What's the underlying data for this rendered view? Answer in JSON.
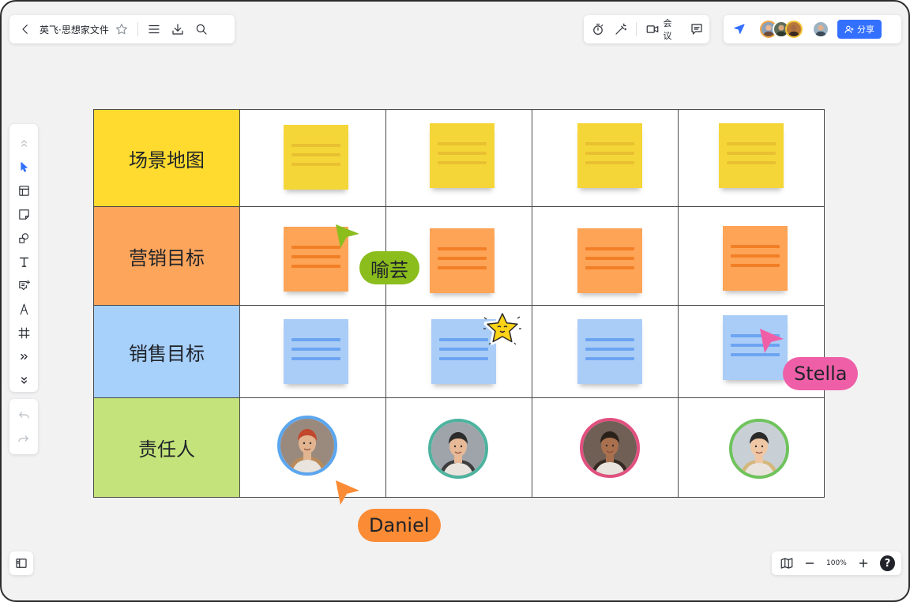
{
  "toolbar": {
    "doc_title": "英飞·思想家文件",
    "meeting_label": "会议",
    "share_label": "分享"
  },
  "zoom": {
    "level": "100%",
    "help": "?"
  },
  "board": {
    "rows": [
      {
        "label": "场景地图",
        "label_color": "#fedb2e",
        "note_color": "#f5d638",
        "note_line_color": "#e8c031"
      },
      {
        "label": "营销目标",
        "label_color": "#fea55c",
        "note_color": "#fda457",
        "note_line_color": "#f27f25"
      },
      {
        "label": "销售目标",
        "label_color": "#a7d0fb",
        "note_color": "#aacdf7",
        "note_line_color": "#6da4f2"
      },
      {
        "label": "责任人",
        "label_color": "#c4e37a"
      }
    ],
    "owners": [
      {
        "ring_color": "#5ba6ef",
        "bg": "#9a8a7e",
        "skin": "#e2b590",
        "hat": "#c1472d",
        "hair": "#c08a52"
      },
      {
        "ring_color": "#4db39f",
        "bg": "#9fa4aa",
        "skin": "#e7b997",
        "hat": "#2c2c2c",
        "hair": "#2c2c2c"
      },
      {
        "ring_color": "#e1507f",
        "bg": "#6f5f55",
        "skin": "#a9704e",
        "hat": "#2b211b",
        "hair": "#2b211b"
      },
      {
        "ring_color": "#6fc35d",
        "bg": "#c8d0d5",
        "skin": "#f0c7a5",
        "hat": "#2a2a2a",
        "hair": "#d6b36a"
      }
    ]
  },
  "collaborators": [
    {
      "name": "喻芸",
      "color": "#8bbd1d"
    },
    {
      "name": "Stella",
      "color": "#ef5fa7"
    },
    {
      "name": "Daniel",
      "color": "#fb8b34"
    }
  ],
  "colors": {
    "accent": "#3370ff"
  }
}
